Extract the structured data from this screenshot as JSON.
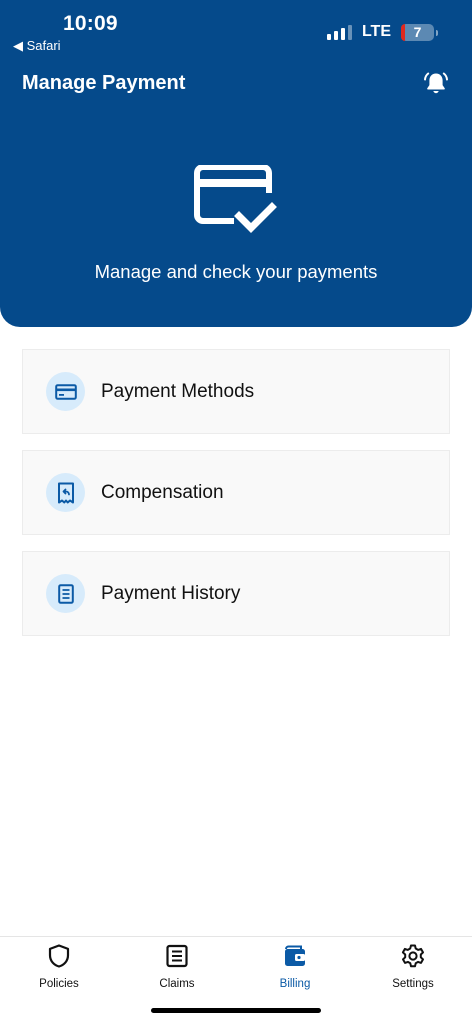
{
  "status_bar": {
    "time": "10:09",
    "back_label": "◀ Safari",
    "network": "LTE",
    "battery": "7"
  },
  "header": {
    "title": "Manage Payment",
    "subtitle": "Manage and check your payments"
  },
  "menu": [
    {
      "label": "Payment Methods",
      "icon": "credit-card-icon"
    },
    {
      "label": "Compensation",
      "icon": "receipt-refund-icon"
    },
    {
      "label": "Payment History",
      "icon": "document-list-icon"
    }
  ],
  "tabs": [
    {
      "label": "Policies",
      "icon": "shield-icon"
    },
    {
      "label": "Claims",
      "icon": "document-list-icon"
    },
    {
      "label": "Billing",
      "icon": "wallet-icon",
      "active": true
    },
    {
      "label": "Settings",
      "icon": "gear-icon"
    }
  ],
  "colors": {
    "header_bg": "#054a8b",
    "icon_circle_bg": "#d7ebfb",
    "icon_blue": "#0b5aa6",
    "active_tab": "#0b5aa6"
  }
}
